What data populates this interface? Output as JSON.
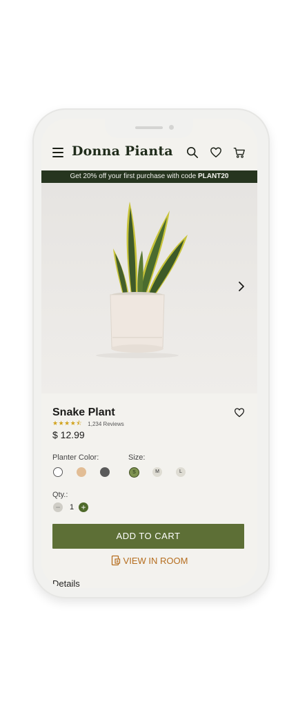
{
  "header": {
    "logo": "Donna Pianta"
  },
  "promo": {
    "text": "Get 20% off your first purchase with code ",
    "code": "PLANT20"
  },
  "product": {
    "name": "Snake Plant",
    "rating": 4.5,
    "reviews": "1,234 Reviews",
    "price": "$ 12.99"
  },
  "options": {
    "planter_label": "Planter Color:",
    "planter_colors": [
      "#ffffff",
      "#e2bd95",
      "#5a5a5a"
    ],
    "size_label": "Size:",
    "sizes": [
      "S",
      "M",
      "L"
    ],
    "selected_size": "S"
  },
  "quantity": {
    "label": "Qty.:",
    "value": "1",
    "minus": "−",
    "plus": "+"
  },
  "actions": {
    "add_to_cart": "ADD TO CART",
    "view_in_room": "VIEW IN ROOM"
  },
  "sections": {
    "details": "Details"
  },
  "colors": {
    "brand_dark": "#26351f",
    "accent_green": "#5d6f36",
    "accent_orange": "#b56d1e",
    "star": "#d1a21b"
  }
}
